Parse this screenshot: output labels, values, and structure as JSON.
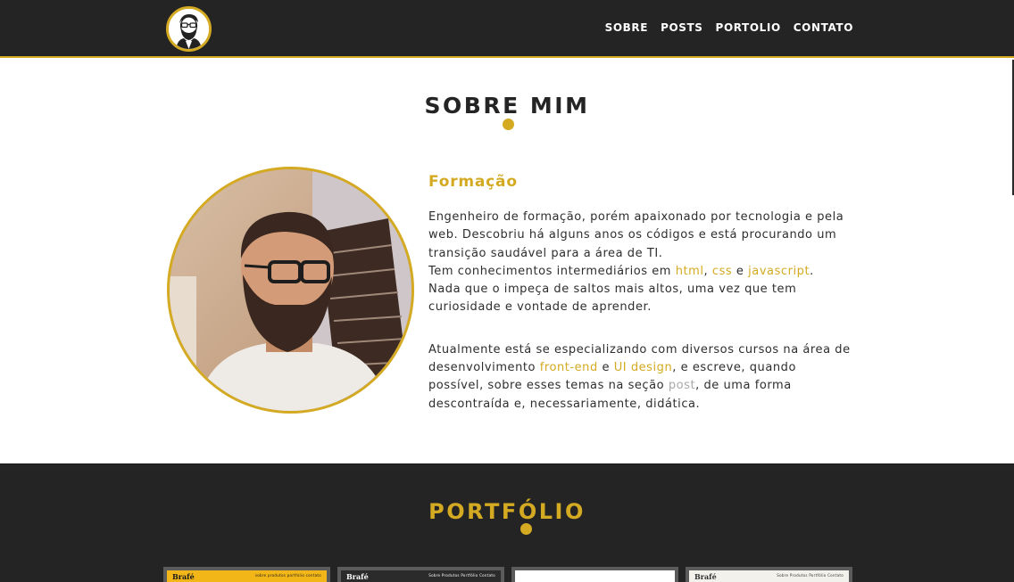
{
  "nav": {
    "items": [
      {
        "label": "SOBRE"
      },
      {
        "label": "POSTS"
      },
      {
        "label": "PORTOLIO"
      },
      {
        "label": "CONTATO"
      }
    ]
  },
  "about": {
    "title": "SOBRE MIM",
    "heading": "Formação",
    "p1": {
      "intro": "Engenheiro de formação, porém apaixonado por tecnologia e pela web. Descobriu há alguns anos os códigos e está procurando um transição saudável para a área de TI.",
      "skills_prefix": "Tem conhecimentos intermediários em ",
      "skill1": "html",
      "sep1": ", ",
      "skill2": "css",
      "sep2": " e ",
      "skill3": "javascript",
      "skills_suffix": ".",
      "closing": "Nada que o impeça de saltos mais altos, uma vez que tem curiosidade e vontade de aprender."
    },
    "p2": {
      "prefix": "Atualmente está se especializando com diversos cursos na área de desenvolvimento ",
      "topic1": "front-end",
      "sep": " e ",
      "topic2": "UI design",
      "middle": ", e escreve, quando possível, sobre esses temas na seção ",
      "post_link": "post",
      "suffix": ", de uma forma descontraída e, necessariamente, didática."
    }
  },
  "portfolio": {
    "title": "PORTFÓLIO",
    "thumbs": [
      {
        "title": "Brafé",
        "links": "sobre  produtos  portfolio  contato",
        "bar_color": "#f2b619",
        "text_color": "#1a1a1a"
      },
      {
        "title": "Brafé",
        "links": "Sobre  Produtos  Portfólio  Contato",
        "bar_color": "#2b2b2b",
        "text_color": "#ffffff"
      },
      {
        "title": "",
        "links": "",
        "bar_color": "#ffffff",
        "text_color": "#333333"
      },
      {
        "title": "Brafé",
        "links": "Sobre  Produtos  Portfólio  Contato",
        "bar_color": "#f3f1ec",
        "text_color": "#333333"
      }
    ]
  },
  "colors": {
    "accent": "#d4aa22",
    "dark": "#242424"
  }
}
